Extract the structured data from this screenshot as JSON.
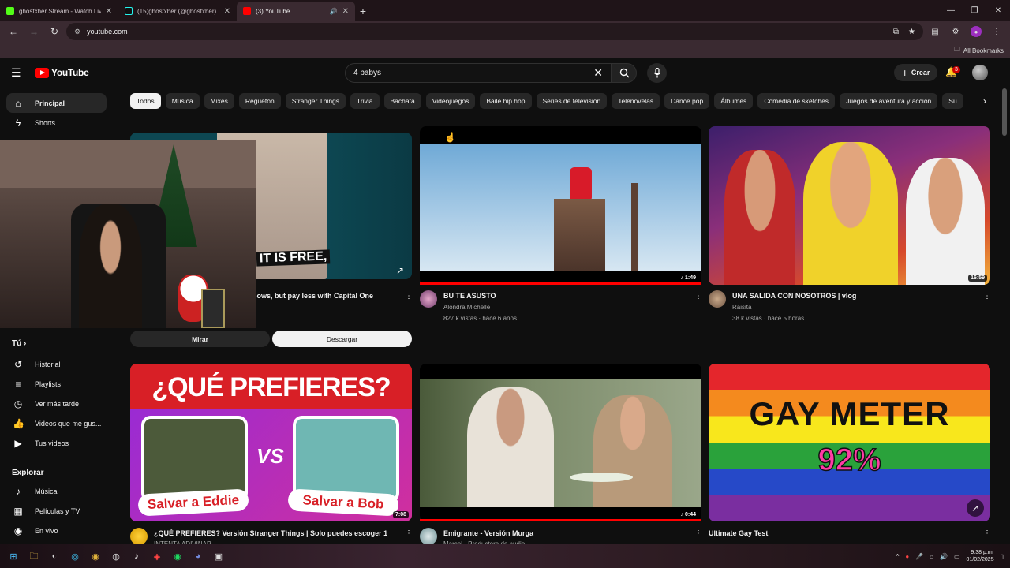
{
  "browser": {
    "tabs": [
      {
        "title": "ghostxher Stream - Watch Live",
        "icon_color": "#53fc18",
        "active": false
      },
      {
        "title": "(15)ghostxher (@ghostxher) | T",
        "icon_color": "#111111",
        "active": false
      },
      {
        "title": "(3) YouTube",
        "icon_color": "#ff0000",
        "active": true
      }
    ],
    "new_tab": "+",
    "url": "youtube.com",
    "bookmarks_label": "All Bookmarks",
    "profile_initial": "●"
  },
  "header": {
    "logo_text": "YouTube",
    "search_value": "4 babys",
    "create_label": "Crear",
    "notification_count": "3"
  },
  "sidebar": {
    "items_top": [
      {
        "label": "Principal",
        "icon": "home-icon",
        "active": true
      },
      {
        "label": "Shorts",
        "icon": "shorts-icon",
        "active": false
      }
    ],
    "you_header": "Tú",
    "you_items": [
      {
        "label": "Historial",
        "icon": "history-icon"
      },
      {
        "label": "Playlists",
        "icon": "playlists-icon"
      },
      {
        "label": "Ver más tarde",
        "icon": "watch-later-icon"
      },
      {
        "label": "Videos que me gus...",
        "icon": "liked-videos-icon"
      },
      {
        "label": "Tus videos",
        "icon": "your-videos-icon"
      }
    ],
    "explore_header": "Explorar",
    "explore_items": [
      {
        "label": "Música",
        "icon": "music-icon"
      },
      {
        "label": "Películas y TV",
        "icon": "movies-icon"
      },
      {
        "label": "En vivo",
        "icon": "live-icon"
      }
    ]
  },
  "chips": [
    "Todos",
    "Música",
    "Mixes",
    "Reguetón",
    "Stranger Things",
    "Trivia",
    "Bachata",
    "Videojuegos",
    "Baile hip hop",
    "Series de televisión",
    "Telenovelas",
    "Dance pop",
    "Álbumes",
    "Comedia de sketches",
    "Juegos de aventura y acción",
    "Su"
  ],
  "ad": {
    "title": "shows, but pay less with Capital One",
    "channel_fragment": "ng",
    "overlay_text": "IT IS FREE,",
    "watch_label": "Mirar",
    "download_label": "Descargar"
  },
  "videos": [
    {
      "title": "BU TE ASUSTO",
      "channel": "Alondra Michelle",
      "meta": "827 k vistas · hace 6 años",
      "duration": "♪ 1:49"
    },
    {
      "title": "UNA SALIDA CON NOSOTROS | vlog",
      "channel": "Raisita",
      "meta": "38 k vistas · hace 5 horas",
      "duration": "16:59"
    },
    {
      "title": "¿QUÉ PREFIERES? Versión Stranger Things | Solo puedes escoger 1",
      "channel": "INTENTA ADIVINAR",
      "duration": "7:08",
      "thumb_heading": "¿QUÉ PREFIERES?",
      "option_a": "Salvar a Eddie",
      "option_b": "Salvar a Bob",
      "vs": "VS"
    },
    {
      "title": "Emigrante - Versión Murga",
      "channel": "Marcel · Productora de audio",
      "duration": "♪ 0:44"
    },
    {
      "title": "Ultimate Gay Test",
      "channel": "",
      "thumb_heading": "GAY METER",
      "thumb_value": "92%"
    }
  ],
  "taskbar": {
    "time": "9:38 p.m.",
    "date": "01/02/2025"
  }
}
